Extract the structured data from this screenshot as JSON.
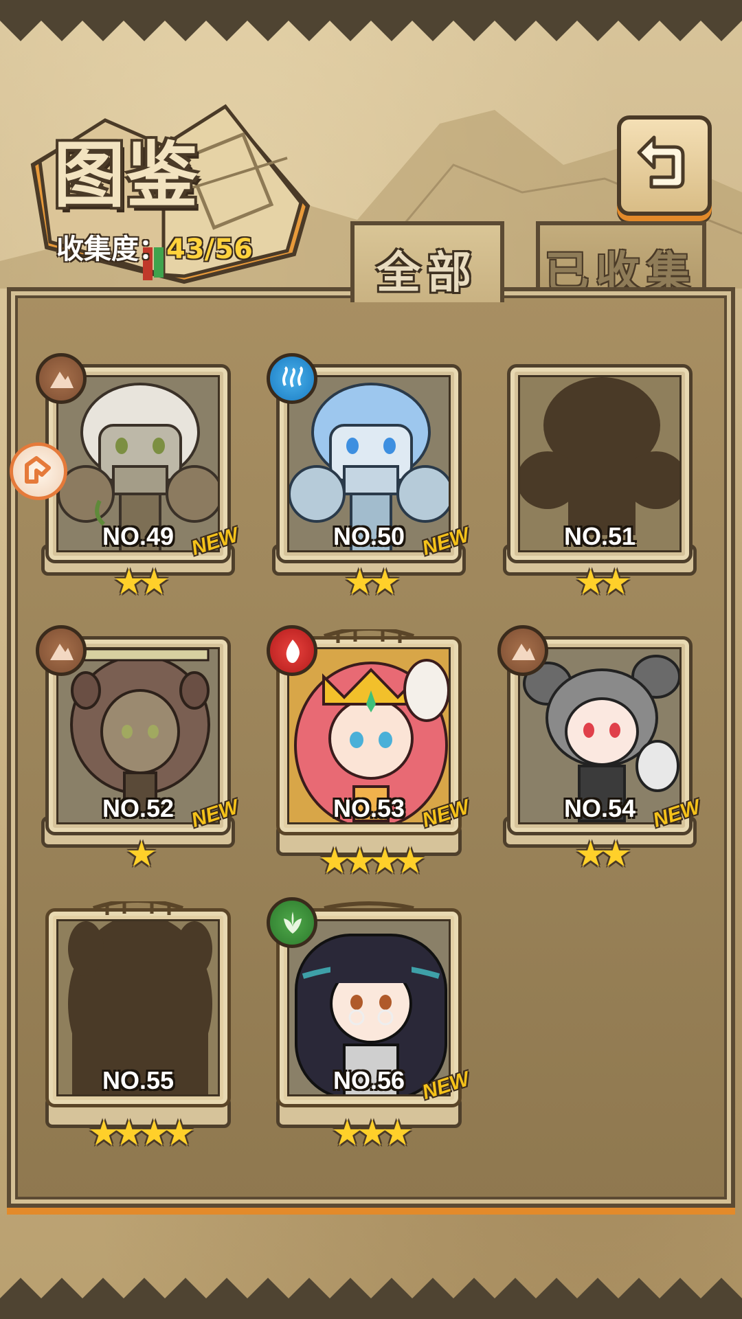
{
  "title": "图鉴",
  "collection": {
    "label": "收集度：",
    "value": "43/56"
  },
  "tabs": [
    {
      "label": "全部",
      "active": true
    },
    {
      "label": "已收集",
      "active": false
    }
  ],
  "cards": [
    {
      "no": "NO.49",
      "stars": "★★",
      "new": "NEW",
      "element": "earth-icon",
      "collected": true,
      "role_badge": true
    },
    {
      "no": "NO.50",
      "stars": "★★",
      "new": "NEW",
      "element": "water-icon",
      "collected": true
    },
    {
      "no": "NO.51",
      "stars": "★★",
      "new": "",
      "element": "",
      "collected": false
    },
    {
      "no": "NO.52",
      "stars": "★",
      "new": "NEW",
      "element": "earth-icon",
      "collected": true
    },
    {
      "no": "NO.53",
      "stars": "★★★★",
      "new": "NEW",
      "element": "fire-icon",
      "collected": true,
      "ornate": true
    },
    {
      "no": "NO.54",
      "stars": "★★",
      "new": "NEW",
      "element": "earth-icon",
      "collected": true
    },
    {
      "no": "NO.55",
      "stars": "★★★★",
      "new": "",
      "element": "",
      "collected": false,
      "ornate": true
    },
    {
      "no": "NO.56",
      "stars": "★★★",
      "new": "NEW",
      "element": "wood-icon",
      "collected": true,
      "ornate": true
    }
  ],
  "colors": {
    "star": "#ffd02a",
    "new": "#f5c21a",
    "accent": "#e38a2a",
    "collect_value": "#ffd23c"
  }
}
